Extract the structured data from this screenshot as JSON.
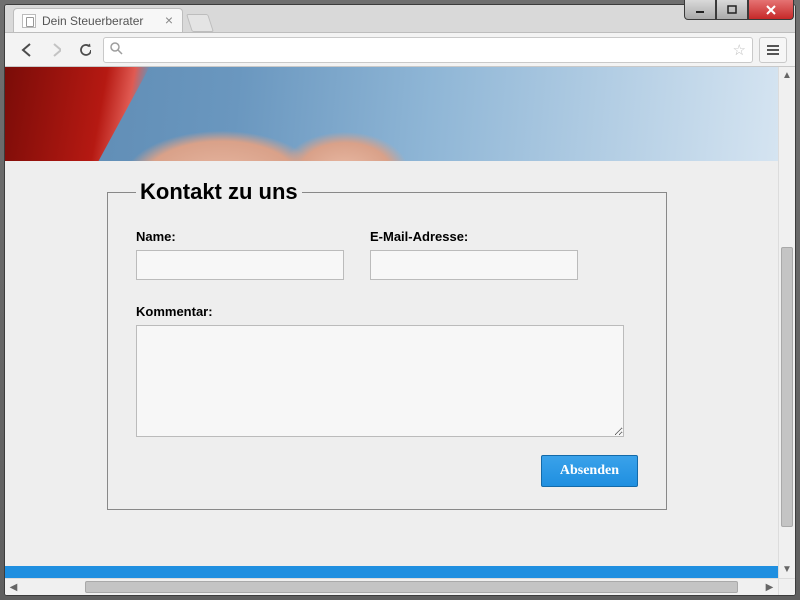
{
  "browser": {
    "tab_title": "Dein Steuerberater",
    "url": ""
  },
  "form": {
    "legend": "Kontakt zu uns",
    "name_label": "Name:",
    "name_value": "",
    "email_label": "E-Mail-Adresse:",
    "email_value": "",
    "comment_label": "Kommentar:",
    "comment_value": "",
    "submit_label": "Absenden"
  }
}
